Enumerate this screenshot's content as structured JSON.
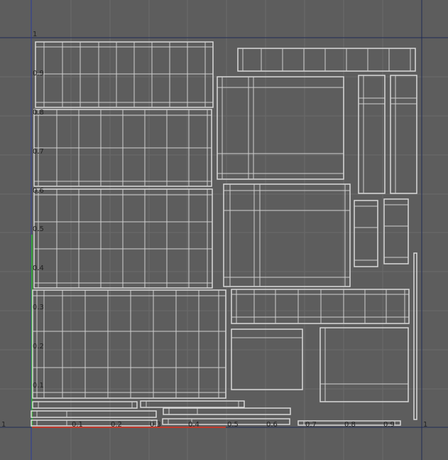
{
  "viewport": {
    "type": "uv-editor",
    "u_tick_labels": [
      "0.1",
      "0.2",
      "0.3",
      "0.4",
      "0.5",
      "0.6",
      "0.7",
      "0.8",
      "0.9"
    ],
    "v_tick_labels": [
      "0.9",
      "0.8",
      "0.7",
      "0.6",
      "0.5",
      "0.4",
      "0.3",
      "0.2",
      "0.1"
    ],
    "corner_labels": {
      "u_max": "1",
      "v_max": "1",
      "origin_left": "1"
    },
    "colors": {
      "background": "#5d5d5d",
      "grid": "#6a6a6a",
      "u_axis": "#c0392b",
      "v_axis": "#3aa838",
      "frame_line": "#1f2a55",
      "islands": "#d9d9d9"
    }
  }
}
